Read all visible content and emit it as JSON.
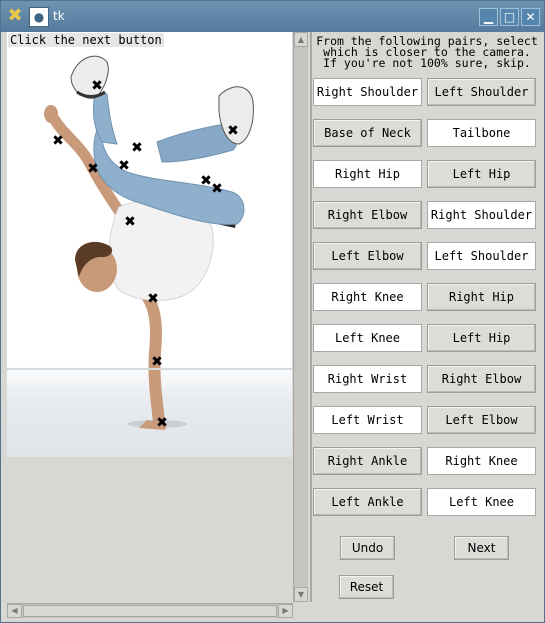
{
  "window": {
    "title": "tk",
    "logo_glyph": "✖",
    "menu_glyph": "●",
    "minimize_glyph": "▁",
    "maximize_glyph": "□",
    "close_glyph": "✕"
  },
  "canvas": {
    "instruction": "Click the next button",
    "marker_glyph": "✖"
  },
  "panel": {
    "prompt": "From the following pairs, select\nwhich is closer to the camera.\nIf you're not 100% sure, skip.",
    "pairs": [
      {
        "left": "Right Shoulder",
        "right": "Left Shoulder"
      },
      {
        "left": "Base of Neck",
        "right": "Tailbone"
      },
      {
        "left": "Right Hip",
        "right": "Left Hip"
      },
      {
        "left": "Right Elbow",
        "right": "Right Shoulder"
      },
      {
        "left": "Left Elbow",
        "right": "Left Shoulder"
      },
      {
        "left": "Right Knee",
        "right": "Right Hip"
      },
      {
        "left": "Left Knee",
        "right": "Left Hip"
      },
      {
        "left": "Right Wrist",
        "right": "Right Elbow"
      },
      {
        "left": "Left Wrist",
        "right": "Left Elbow"
      },
      {
        "left": "Right Ankle",
        "right": "Right Knee"
      },
      {
        "left": "Left Ankle",
        "right": "Left Knee"
      }
    ],
    "undo_label": "Undo",
    "next_label": "Next",
    "reset_label": "Reset"
  },
  "scrollbars": {
    "up_glyph": "▲",
    "down_glyph": "▼",
    "left_glyph": "◀",
    "right_glyph": "▶"
  }
}
